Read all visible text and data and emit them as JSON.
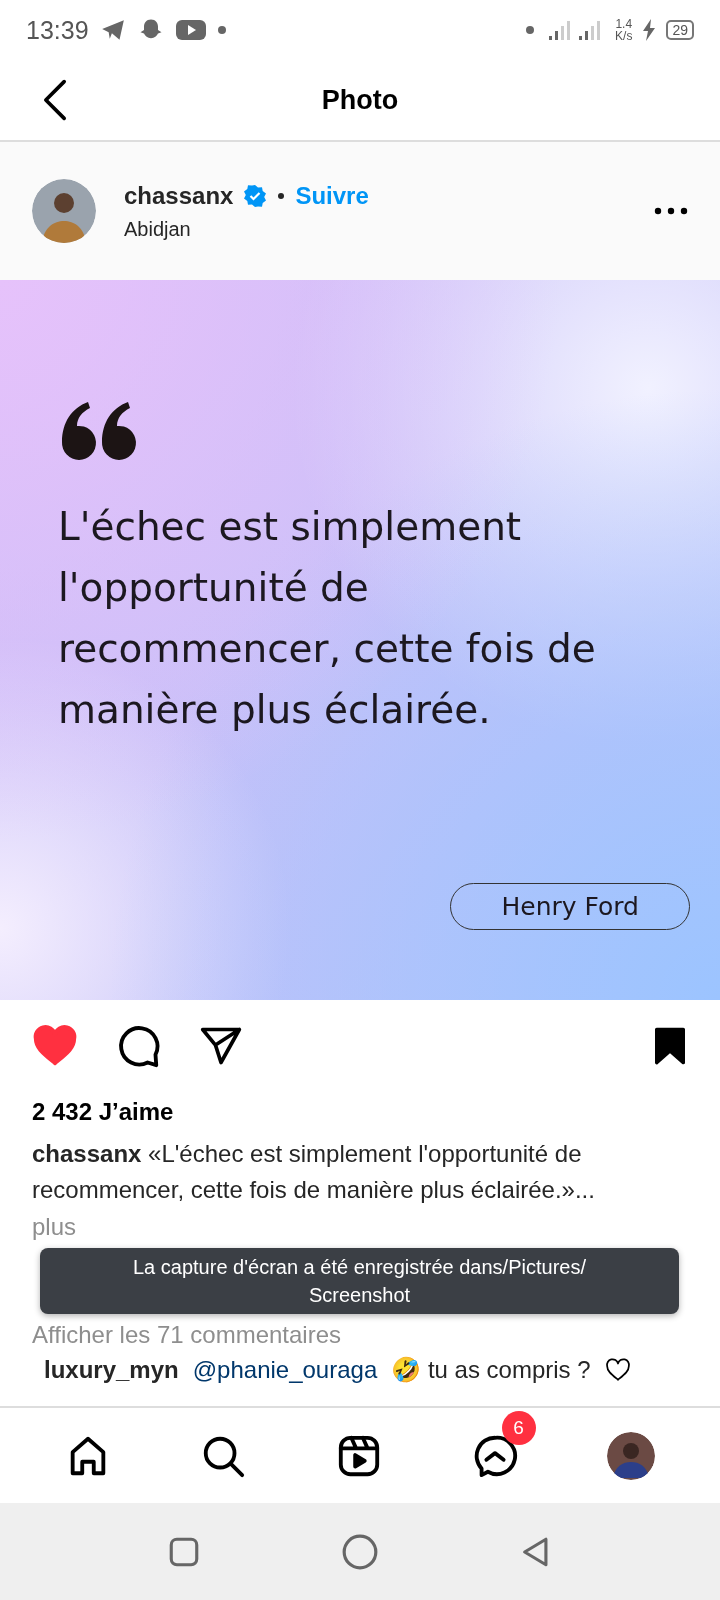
{
  "status_bar": {
    "time": "13:39",
    "speed_value": "1.4",
    "speed_unit": "K/s",
    "battery": "29"
  },
  "header": {
    "title": "Photo"
  },
  "post": {
    "username": "chassanx",
    "verified": true,
    "follow": "Suivre",
    "location": "Abidjan",
    "quote": "L'échec est simplement l'opportunité de recommencer, cette fois de manière plus éclairée.",
    "author": "Henry Ford",
    "liked": true,
    "saved": true,
    "likes": "2 432 J’aime",
    "caption_user": "chassanx",
    "caption": "«L'échec est simplement l'opportunité de recommencer, cette fois de manière plus éclairée.»...",
    "more": "plus",
    "comments_link": "Afficher les 71 commentaires",
    "comment": {
      "user": "luxury_myn",
      "mention": "@phanie_ouraga",
      "text": "🤣 tu as compris ?"
    }
  },
  "toast": {
    "message": "La capture d'écran a été enregistrée dans/Pictures/ Screenshot"
  },
  "bottom_nav": {
    "messages_badge": "6"
  }
}
